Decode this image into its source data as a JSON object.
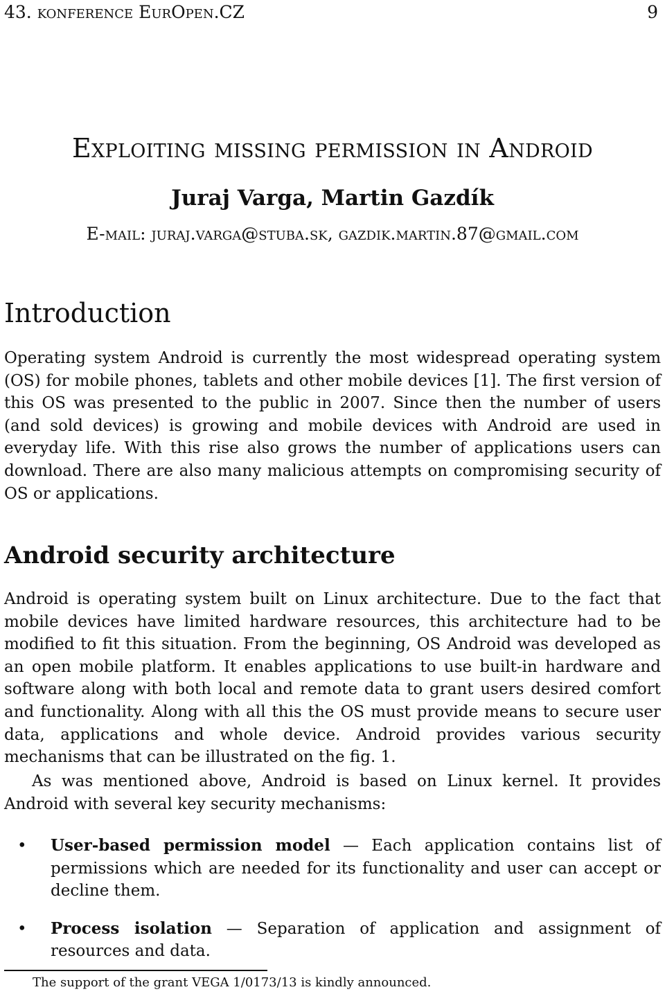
{
  "running_head": {
    "left": "43. konference EurOpen.CZ",
    "page_number": "9"
  },
  "title": "Exploiting missing permission in Android",
  "authors": "Juraj Varga, Martin Gazdík",
  "emails": "E-mail: juraj.varga@stuba.sk, gazdik.martin.87@gmail.com",
  "sections": [
    {
      "heading": "Introduction",
      "paragraphs": [
        "Operating system Android is currently the most widespread operating system (OS) for mobile phones, tablets and other mobile devices [1]. The first version of this OS was presented to the public in 2007. Since then the number of users (and sold devices) is growing and mobile devices with Android are used in everyday life. With this rise also grows the number of applications users can download. There are also many malicious attempts on compromising security of OS or applications."
      ]
    },
    {
      "heading": "Android security architecture",
      "paragraphs": [
        "Android is operating system built on Linux architecture. Due to the fact that mobile devices have limited hardware resources, this architecture had to be modified to fit this situation. From the beginning, OS Android was developed as an open mobile platform. It enables applications to use built-in hardware and software along with both local and remote data to grant users desired comfort and functionality. Along with all this the OS must provide means to secure user data, applications and whole device. Android provides various security mechanisms that can be illustrated on the fig. 1.",
        "As was mentioned above, Android is based on Linux kernel. It provides Android with several key security mechanisms:"
      ],
      "bullets": [
        {
          "term": "User-based permission model",
          "separator": " — ",
          "text": "Each application contains list of permissions which are needed for its functionality and user can accept or decline them."
        },
        {
          "term": "Process isolation",
          "separator": " — ",
          "text": "Separation of application and assignment of resources and data."
        }
      ]
    }
  ],
  "footnote": "The support of the grant VEGA 1/0173/13 is kindly announced."
}
